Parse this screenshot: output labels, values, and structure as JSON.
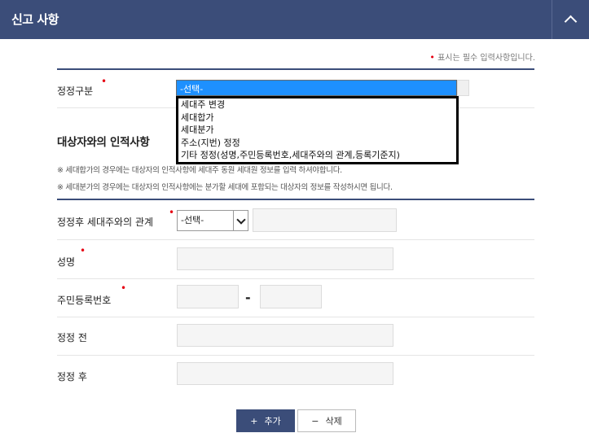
{
  "header": {
    "title": "신고 사항",
    "toggle_icon": "chevron-up-icon"
  },
  "required_note": {
    "marker": "•",
    "text": "표시는 필수 입력사항입니다."
  },
  "correction_type": {
    "label": "정정구분",
    "selected": "-선택-",
    "options": [
      "세대주 변경",
      "세대합가",
      "세대분가",
      "주소(지번) 정정",
      "기타 정정(성명,주민등록번호,세대주와의 관계,등록기준지)"
    ]
  },
  "personal_section": {
    "title": "대상자와의 인적사항",
    "notice_1": "※ 세대합가의 경우에는 대상자의 인적사항에 세대주 동원 세대원 정보를 입력 하셔야합니다.",
    "notice_2": "※ 세대분가의 경우에는 대상자의 인적사항에는 분가할 세대에 포함되는 대상자의 정보를 작성하시면 됩니다."
  },
  "form": {
    "relation_label": "정정후 세대주와의 관계",
    "relation_selected": "-선택-",
    "relation_value": "",
    "name_label": "성명",
    "name_value": "",
    "rrn_label": "주민등록번호",
    "rrn_front": "",
    "rrn_separator": "-",
    "rrn_back": "",
    "before_label": "정정 전",
    "before_value": "",
    "after_label": "정정 후",
    "after_value": ""
  },
  "buttons": {
    "add_icon": "+",
    "add_label": "추가",
    "delete_icon": "−",
    "delete_label": "삭제"
  },
  "colors": {
    "header_bg": "#3b4d79",
    "required": "#e60012",
    "selected_option": "#1e90ff"
  }
}
